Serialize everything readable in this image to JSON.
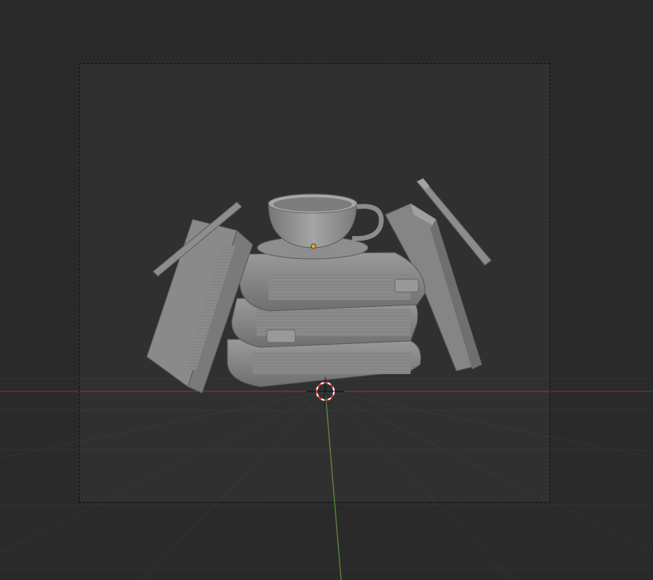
{
  "viewport": {
    "background_color": "#2a2a2a",
    "camera_frame_fill": "#383838",
    "grid_color": "#323232",
    "x_axis_color": "#7a3b3b",
    "y_axis_color": "#5f8a3a",
    "mesh_color": "#8c8c8c",
    "mesh_shadow_color": "#6e6e6e",
    "mesh_highlight_color": "#a4a4a4",
    "origin_dot_color": "#f0a030",
    "cursor_ring_colors": [
      "#d33a3a",
      "#ffffff"
    ]
  },
  "scene": {
    "objects": [
      "stacked-books",
      "tea-cup",
      "saucer",
      "left-leaning-book",
      "right-standing-book",
      "left-pencil",
      "right-pen"
    ],
    "icons": [
      "3d-cursor-icon",
      "object-origin-icon"
    ]
  }
}
